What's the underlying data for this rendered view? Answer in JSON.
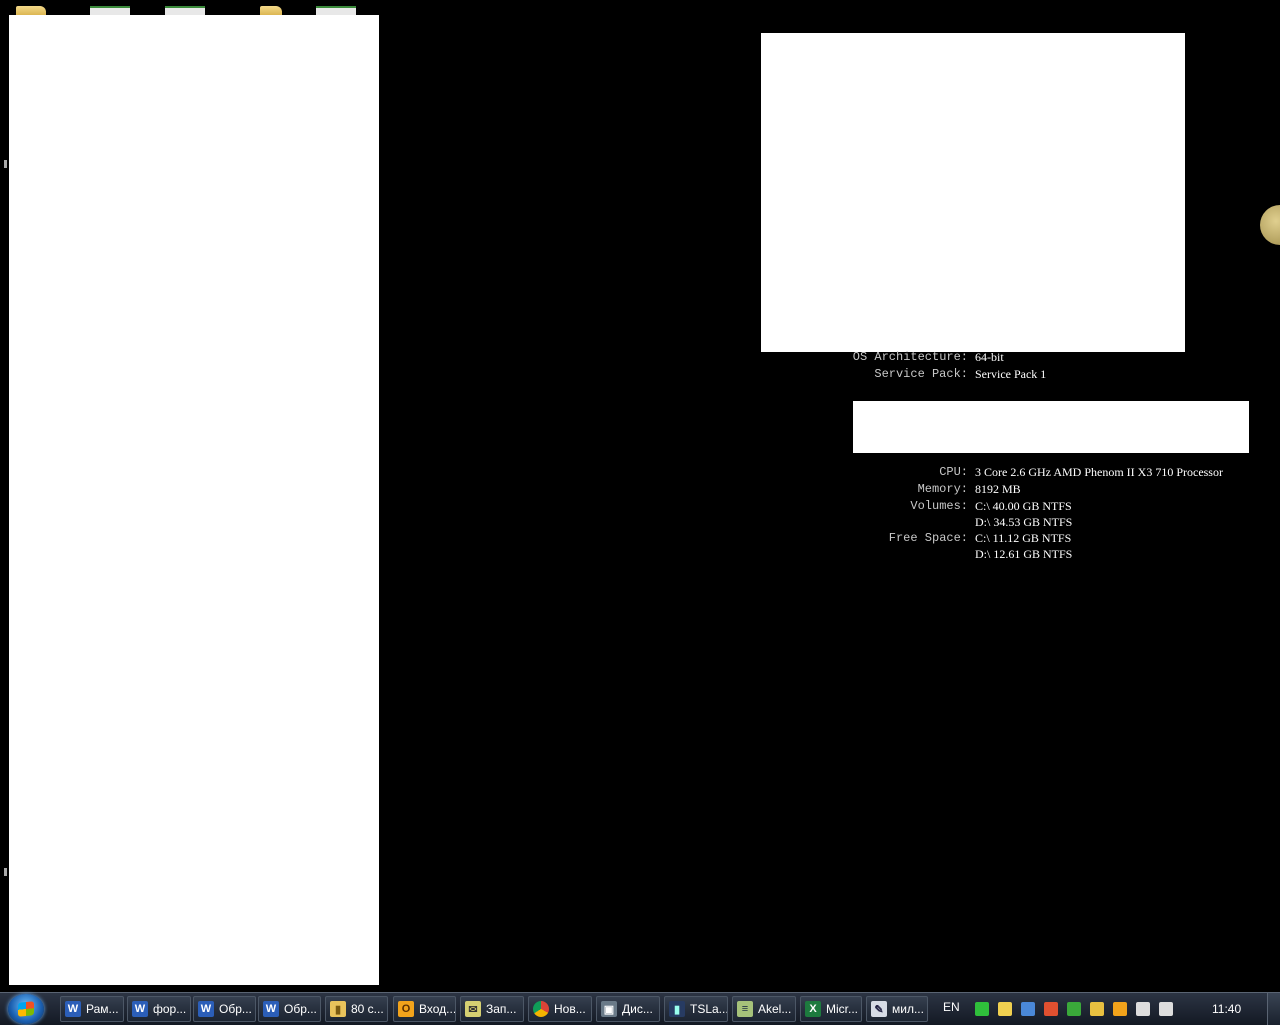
{
  "system_info": {
    "rows": [
      {
        "label": "OS Architecture:",
        "value": "64-bit"
      },
      {
        "label": "Service Pack:",
        "value": "Service Pack 1"
      }
    ],
    "hardware": [
      {
        "label": "CPU:",
        "value": "3 Core 2.6 GHz AMD Phenom II X3 710 Processor"
      },
      {
        "label": "Memory:",
        "value": "8192 MB"
      },
      {
        "label": "Volumes:",
        "value": "C:\\ 40.00 GB NTFS"
      },
      {
        "label": "",
        "value": "D:\\ 34.53 GB NTFS"
      },
      {
        "label": "Free Space:",
        "value": "C:\\ 11.12 GB NTFS"
      },
      {
        "label": "",
        "value": "D:\\ 12.61 GB NTFS"
      }
    ]
  },
  "taskbar": {
    "buttons": [
      {
        "label": "Рам...",
        "icon": "word-icon",
        "glyph": "W"
      },
      {
        "label": "фор...",
        "icon": "word-icon",
        "glyph": "W"
      },
      {
        "label": "Обр...",
        "icon": "word-icon",
        "glyph": "W"
      },
      {
        "label": "Обр...",
        "icon": "word-icon",
        "glyph": "W"
      },
      {
        "label": "80 с...",
        "icon": "folder-icon",
        "glyph": "▮"
      },
      {
        "label": "Вход...",
        "icon": "outlook-icon",
        "glyph": "O"
      },
      {
        "label": "Зап...",
        "icon": "messenger-icon",
        "glyph": "✉"
      },
      {
        "label": "Нов...",
        "icon": "chrome-icon",
        "glyph": ""
      },
      {
        "label": "Дис...",
        "icon": "task-manager-icon",
        "glyph": "▣"
      },
      {
        "label": "TSLa...",
        "icon": "chart-icon",
        "glyph": "▮"
      },
      {
        "label": "Akel...",
        "icon": "notepad-icon",
        "glyph": "≡"
      },
      {
        "label": "Micr...",
        "icon": "excel-icon",
        "glyph": "X"
      },
      {
        "label": "мил...",
        "icon": "editor-icon",
        "glyph": "✎"
      }
    ],
    "language": "EN",
    "clock": "11:40",
    "tray_colors": [
      "#2fbf3b",
      "#f0d050",
      "#4a88d8",
      "#e05030",
      "#3aa83a",
      "#e8c040",
      "#f2a31b",
      "#dddddd",
      "#dddddd"
    ]
  }
}
